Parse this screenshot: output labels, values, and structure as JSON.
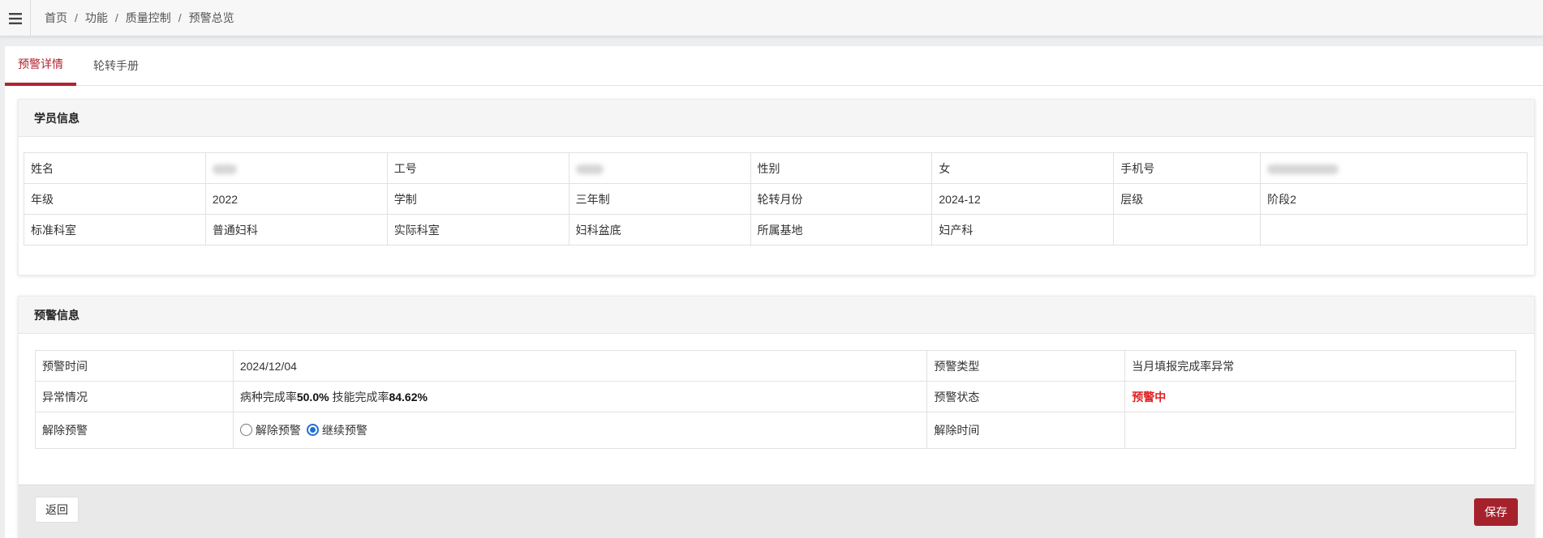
{
  "breadcrumb": [
    "首页",
    "功能",
    "质量控制",
    "预警总览"
  ],
  "tabs": [
    "预警详情",
    "轮转手册"
  ],
  "student_panel": {
    "title": "学员信息",
    "rows": [
      [
        "姓名",
        "",
        "工号",
        "",
        "性别",
        "女",
        "手机号",
        ""
      ],
      [
        "年级",
        "2022",
        "学制",
        "三年制",
        "轮转月份",
        "2024-12",
        "层级",
        "阶段2"
      ],
      [
        "标准科室",
        "普通妇科",
        "实际科室",
        "妇科盆底",
        "所属基地",
        "妇产科",
        "",
        ""
      ]
    ]
  },
  "warning_panel": {
    "title": "预警信息",
    "time_label": "预警时间",
    "time_value": "2024/12/04",
    "type_label": "预警类型",
    "type_value": "当月填报完成率异常",
    "abnormal_label": "异常情况",
    "disease_rate_label": "病种完成率",
    "disease_rate_value": "50.0%",
    "skill_rate_label": "技能完成率",
    "skill_rate_value": "84.62%",
    "status_label": "预警状态",
    "status_value": "预警中",
    "release_label": "解除预警",
    "options": [
      "解除预警",
      "继续预警"
    ],
    "selected_option": "继续预警",
    "release_time_label": "解除时间",
    "release_time_value": ""
  },
  "buttons": {
    "back": "返回",
    "save": "保存"
  },
  "colors": {
    "accent": "#b2232f",
    "save_bg": "#a5212c",
    "alert": "#e02020",
    "radio": "#1f6fd1"
  }
}
